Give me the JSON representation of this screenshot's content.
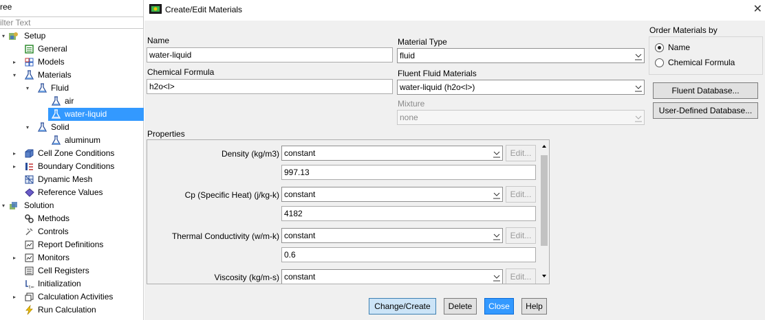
{
  "tree": {
    "title": "ree",
    "filter_placeholder": "ilter Text",
    "nodes": [
      {
        "label": "Setup"
      },
      {
        "label": "General"
      },
      {
        "label": "Models"
      },
      {
        "label": "Materials"
      },
      {
        "label": "Fluid"
      },
      {
        "label": "air"
      },
      {
        "label": "water-liquid"
      },
      {
        "label": "Solid"
      },
      {
        "label": "aluminum"
      },
      {
        "label": "Cell Zone Conditions"
      },
      {
        "label": "Boundary Conditions"
      },
      {
        "label": "Dynamic Mesh"
      },
      {
        "label": "Reference Values"
      },
      {
        "label": "Solution"
      },
      {
        "label": "Methods"
      },
      {
        "label": "Controls"
      },
      {
        "label": "Report Definitions"
      },
      {
        "label": "Monitors"
      },
      {
        "label": "Cell Registers"
      },
      {
        "label": "Initialization"
      },
      {
        "label": "Calculation Activities"
      },
      {
        "label": "Run Calculation"
      }
    ]
  },
  "dialog": {
    "title": "Create/Edit Materials",
    "close_glyph": "✕",
    "name_label": "Name",
    "name_value": "water-liquid",
    "formula_label": "Chemical Formula",
    "formula_value": "h2o<l>",
    "material_type_label": "Material Type",
    "material_type_value": "fluid",
    "fluent_materials_label": "Fluent Fluid Materials",
    "fluent_materials_value": "water-liquid (h2o<l>)",
    "mixture_label": "Mixture",
    "mixture_value": "none",
    "order_label": "Order Materials by",
    "order_options": [
      "Name",
      "Chemical Formula"
    ],
    "fluent_db_button": "Fluent Database...",
    "user_db_button": "User-Defined Database...",
    "properties_label": "Properties",
    "properties": [
      {
        "label": "Density (kg/m3)",
        "method": "constant",
        "edit": "Edit...",
        "value": "997.13"
      },
      {
        "label": "Cp (Specific Heat) (j/kg-k)",
        "method": "constant",
        "edit": "Edit...",
        "value": "4182"
      },
      {
        "label": "Thermal Conductivity (w/m-k)",
        "method": "constant",
        "edit": "Edit...",
        "value": "0.6"
      },
      {
        "label": "Viscosity (kg/m-s)",
        "method": "constant",
        "edit": "Edit..."
      }
    ],
    "buttons": {
      "change": "Change/Create",
      "delete": "Delete",
      "close": "Close",
      "help": "Help"
    }
  },
  "colors": {
    "selection": "#3399ff",
    "dialog_bg": "#f0f0f0",
    "primary_button": "#cce4f7"
  }
}
